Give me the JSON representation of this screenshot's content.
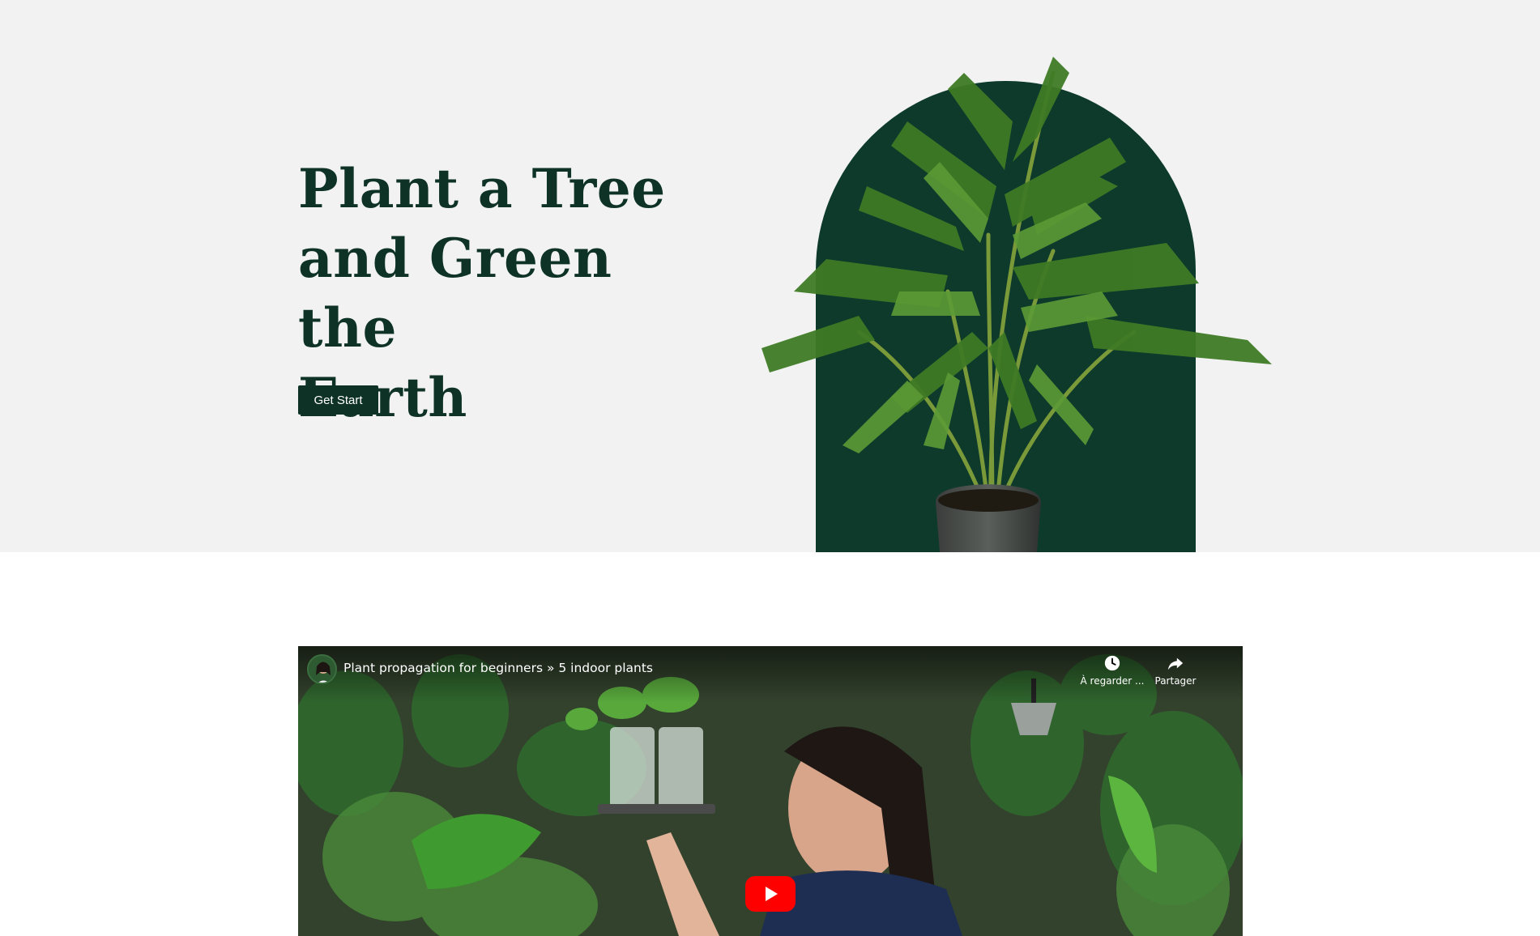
{
  "hero": {
    "title_line1": "Plant a Tree",
    "title_line2": "and Green the",
    "title_line3": "Earth",
    "cta_label": "Get Start"
  },
  "video": {
    "title": "Plant propagation for beginners » 5 indoor plants",
    "watch_later_label": "À regarder ...",
    "share_label": "Partager"
  },
  "colors": {
    "brand_dark_green": "#0e3326",
    "arch_green": "#0d3a2b",
    "hero_background": "#f1f2f1",
    "youtube_red": "#ff0000"
  },
  "icons": {
    "watch_later": "clock-icon",
    "share": "share-arrow-icon",
    "play": "play-icon"
  }
}
